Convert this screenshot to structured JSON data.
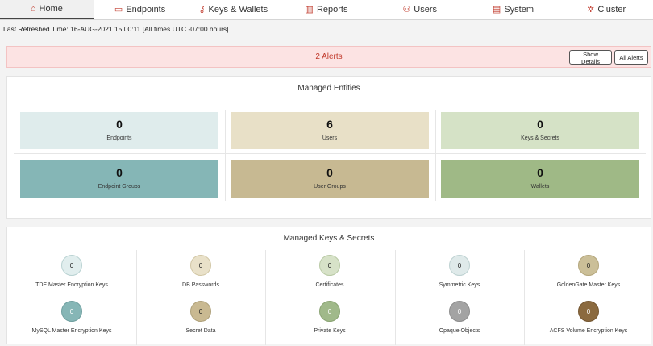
{
  "nav": {
    "tabs": [
      {
        "label": "Home",
        "icon": "home-icon",
        "glyph": "⌂",
        "active": true
      },
      {
        "label": "Endpoints",
        "icon": "monitor-icon",
        "glyph": "▭",
        "active": false
      },
      {
        "label": "Keys & Wallets",
        "icon": "key-icon",
        "glyph": "⚷",
        "active": false
      },
      {
        "label": "Reports",
        "icon": "bar-chart-icon",
        "glyph": "▥",
        "active": false
      },
      {
        "label": "Users",
        "icon": "users-icon",
        "glyph": "⚇",
        "active": false
      },
      {
        "label": "System",
        "icon": "server-icon",
        "glyph": "▤",
        "active": false
      },
      {
        "label": "Cluster",
        "icon": "cluster-icon",
        "glyph": "✲",
        "active": false
      }
    ],
    "accent_color": "#c0392b"
  },
  "refresh": {
    "text": "Last Refreshed Time: 16-AUG-2021 15:00:11 [All times UTC -07:00 hours]"
  },
  "alerts": {
    "text": "2 Alerts",
    "show_details_label": "Show Details",
    "all_alerts_label": "All Alerts",
    "text_color": "#c0392b",
    "background": "#fce3e3"
  },
  "managed_entities": {
    "title": "Managed Entities",
    "tiles": [
      {
        "count": "0",
        "label": "Endpoints",
        "color": "#dfecec"
      },
      {
        "count": "6",
        "label": "Users",
        "color": "#e8e0c7"
      },
      {
        "count": "0",
        "label": "Keys & Secrets",
        "color": "#d5e2c6"
      },
      {
        "count": "0",
        "label": "Endpoint Groups",
        "color": "#85b6b6"
      },
      {
        "count": "0",
        "label": "User Groups",
        "color": "#c7b992"
      },
      {
        "count": "0",
        "label": "Wallets",
        "color": "#9fb986"
      }
    ]
  },
  "managed_keys": {
    "title": "Managed Keys & Secrets",
    "items": [
      {
        "count": "0",
        "label": "TDE Master Encryption Keys",
        "color": "#e1eeee",
        "border": "#b9d2d2"
      },
      {
        "count": "0",
        "label": "DB Passwords",
        "color": "#e9e1c9",
        "border": "#d1c6a4"
      },
      {
        "count": "0",
        "label": "Certificates",
        "color": "#d7e2c8",
        "border": "#b8c9a4"
      },
      {
        "count": "0",
        "label": "Symmetric Keys",
        "color": "#dfeaea",
        "border": "#bdd1d1"
      },
      {
        "count": "0",
        "label": "GoldenGate Master Keys",
        "color": "#cbbf98",
        "border": "#b3a57a"
      },
      {
        "count": "0",
        "label": "MySQL Master Encryption Keys",
        "color": "#86b6b6",
        "border": "#6f9f9f",
        "dark": true
      },
      {
        "count": "0",
        "label": "Secret Data",
        "color": "#c9b991",
        "border": "#aea079"
      },
      {
        "count": "0",
        "label": "Private Keys",
        "color": "#a0b98a",
        "border": "#89a372",
        "dark": true
      },
      {
        "count": "0",
        "label": "Opaque Objects",
        "color": "#a3a3a3",
        "border": "#8c8c8c",
        "dark": true
      },
      {
        "count": "0",
        "label": "ACFS Volume Encryption Keys",
        "color": "#8b6a3f",
        "border": "#735530",
        "dark": true
      }
    ]
  }
}
